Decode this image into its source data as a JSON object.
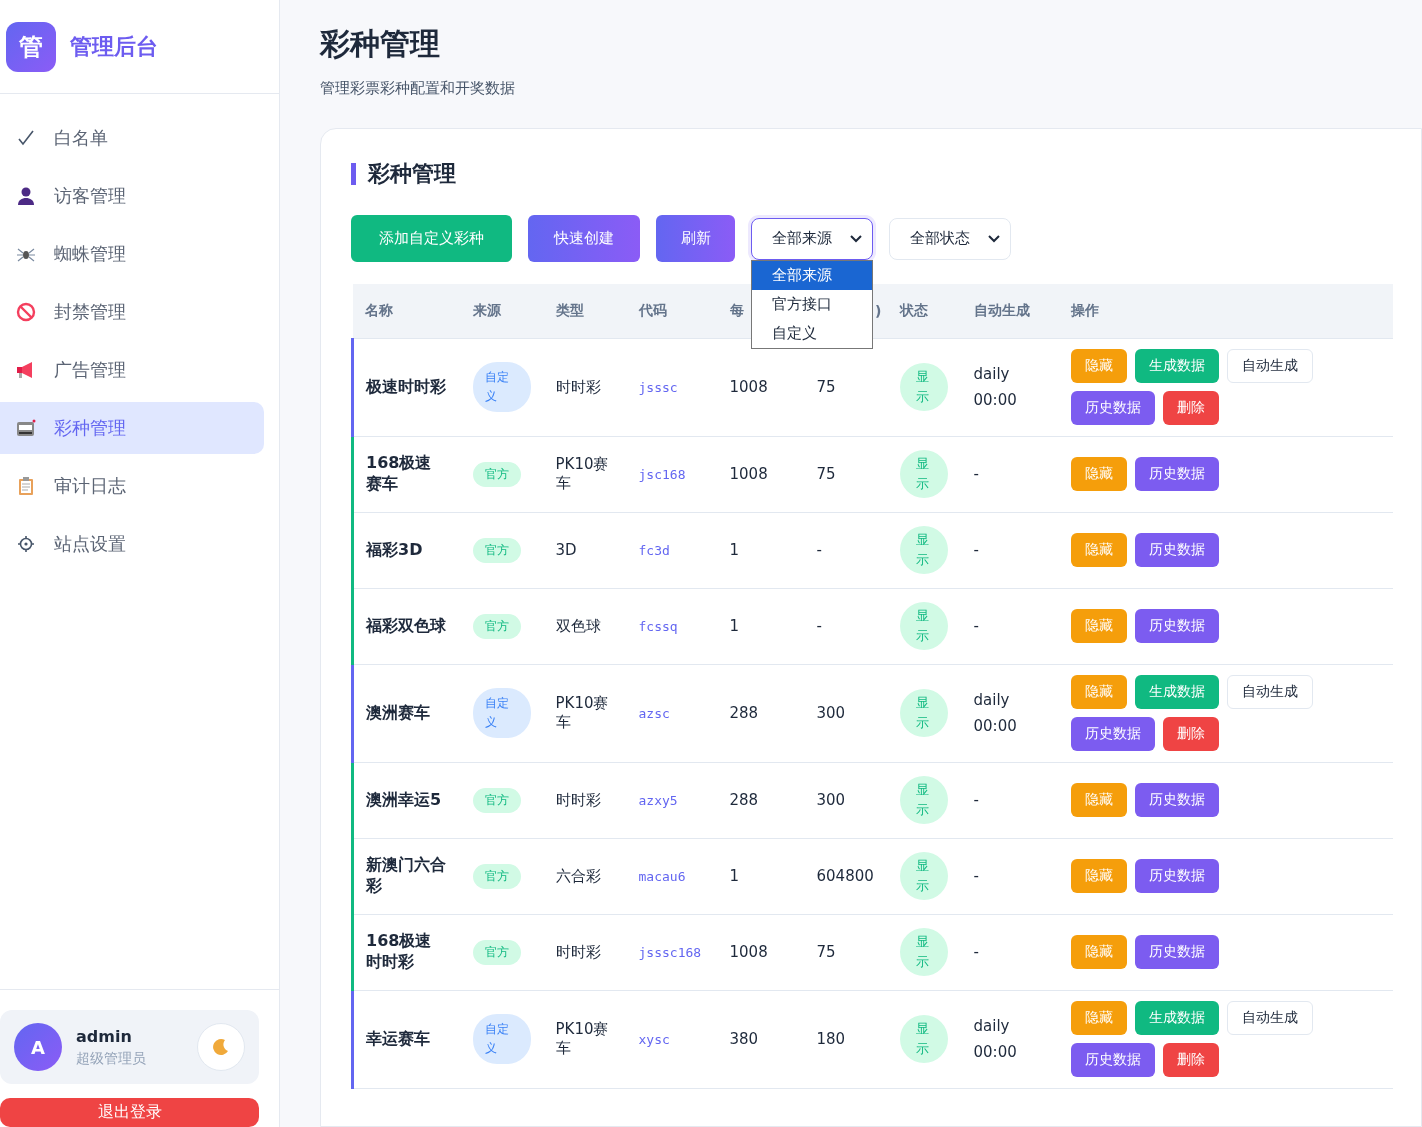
{
  "brand": {
    "logo": "管",
    "title": "管理后台"
  },
  "sidebar": {
    "items": [
      {
        "label": "白名单",
        "selected": false
      },
      {
        "label": "访客管理",
        "selected": false
      },
      {
        "label": "蜘蛛管理",
        "selected": false
      },
      {
        "label": "封禁管理",
        "selected": false
      },
      {
        "label": "广告管理",
        "selected": false
      },
      {
        "label": "彩种管理",
        "selected": true
      },
      {
        "label": "审计日志",
        "selected": false
      },
      {
        "label": "站点设置",
        "selected": false
      }
    ]
  },
  "user": {
    "avatar": "A",
    "name": "admin",
    "role": "超级管理员"
  },
  "logout": "退出登录",
  "page": {
    "title": "彩种管理",
    "subtitle": "管理彩票彩种配置和开奖数据"
  },
  "card": {
    "title": "彩种管理"
  },
  "toolbar": {
    "buttons": [
      {
        "label": "添加自定义彩种",
        "kind": "green"
      },
      {
        "label": "快速创建",
        "kind": "purple"
      },
      {
        "label": "刷新",
        "kind": "purple"
      }
    ],
    "source_select": {
      "value": "全部来源",
      "expanded": true,
      "options": [
        {
          "label": "全部来源",
          "selected": true
        },
        {
          "label": "官方接口",
          "selected": false
        },
        {
          "label": "自定义",
          "selected": false
        }
      ]
    },
    "status_select": {
      "value": "全部状态"
    }
  },
  "table": {
    "columns": [
      "名称",
      "来源",
      "类型",
      "代码",
      "每",
      ")",
      "状态",
      "自动生成",
      "操作"
    ],
    "rows": [
      {
        "name": "极速时时彩",
        "source": {
          "label": "自定义",
          "kind": "custom"
        },
        "type": "时时彩",
        "code": "jsssc",
        "column_5": "1008",
        "column_6": "75",
        "status": "显示",
        "auto": "daily 00:00",
        "actions": [
          {
            "label": "隐藏",
            "kind": "hide"
          },
          {
            "label": "生成数据",
            "kind": "generate"
          },
          {
            "label": "自动生成",
            "kind": "auto"
          },
          {
            "label": "历史数据",
            "kind": "history"
          },
          {
            "label": "删除",
            "kind": "delete"
          }
        ]
      },
      {
        "name": "168极速赛车",
        "source": {
          "label": "官方",
          "kind": "official"
        },
        "type": "PK10赛车",
        "code": "jsc168",
        "column_5": "1008",
        "column_6": "75",
        "status": "显示",
        "auto": "-",
        "actions": [
          {
            "label": "隐藏",
            "kind": "hide"
          },
          {
            "label": "历史数据",
            "kind": "history"
          }
        ]
      },
      {
        "name": "福彩3D",
        "source": {
          "label": "官方",
          "kind": "official"
        },
        "type": "3D",
        "code": "fc3d",
        "column_5": "1",
        "column_6": "-",
        "status": "显示",
        "auto": "-",
        "actions": [
          {
            "label": "隐藏",
            "kind": "hide"
          },
          {
            "label": "历史数据",
            "kind": "history"
          }
        ]
      },
      {
        "name": "福彩双色球",
        "source": {
          "label": "官方",
          "kind": "official"
        },
        "type": "双色球",
        "code": "fcssq",
        "column_5": "1",
        "column_6": "-",
        "status": "显示",
        "auto": "-",
        "actions": [
          {
            "label": "隐藏",
            "kind": "hide"
          },
          {
            "label": "历史数据",
            "kind": "history"
          }
        ]
      },
      {
        "name": "澳洲赛车",
        "source": {
          "label": "自定义",
          "kind": "custom"
        },
        "type": "PK10赛车",
        "code": "azsc",
        "column_5": "288",
        "column_6": "300",
        "status": "显示",
        "auto": "daily 00:00",
        "actions": [
          {
            "label": "隐藏",
            "kind": "hide"
          },
          {
            "label": "生成数据",
            "kind": "generate"
          },
          {
            "label": "自动生成",
            "kind": "auto"
          },
          {
            "label": "历史数据",
            "kind": "history"
          },
          {
            "label": "删除",
            "kind": "delete"
          }
        ]
      },
      {
        "name": "澳洲幸运5",
        "source": {
          "label": "官方",
          "kind": "official"
        },
        "type": "时时彩",
        "code": "azxy5",
        "column_5": "288",
        "column_6": "300",
        "status": "显示",
        "auto": "-",
        "actions": [
          {
            "label": "隐藏",
            "kind": "hide"
          },
          {
            "label": "历史数据",
            "kind": "history"
          }
        ]
      },
      {
        "name": "新澳门六合彩",
        "source": {
          "label": "官方",
          "kind": "official"
        },
        "type": "六合彩",
        "code": "macau6",
        "column_5": "1",
        "column_6": "604800",
        "status": "显示",
        "auto": "-",
        "actions": [
          {
            "label": "隐藏",
            "kind": "hide"
          },
          {
            "label": "历史数据",
            "kind": "history"
          }
        ]
      },
      {
        "name": "168极速时时彩",
        "source": {
          "label": "官方",
          "kind": "official"
        },
        "type": "时时彩",
        "code": "jsssc168",
        "column_5": "1008",
        "column_6": "75",
        "status": "显示",
        "auto": "-",
        "actions": [
          {
            "label": "隐藏",
            "kind": "hide"
          },
          {
            "label": "历史数据",
            "kind": "history"
          }
        ]
      },
      {
        "name": "幸运赛车",
        "source": {
          "label": "自定义",
          "kind": "custom"
        },
        "type": "PK10赛车",
        "code": "xysc",
        "column_5": "380",
        "column_6": "180",
        "status": "显示",
        "auto": "daily 00:00",
        "actions": [
          {
            "label": "隐藏",
            "kind": "hide"
          },
          {
            "label": "生成数据",
            "kind": "generate"
          },
          {
            "label": "自动生成",
            "kind": "auto"
          },
          {
            "label": "历史数据",
            "kind": "history"
          },
          {
            "label": "删除",
            "kind": "delete"
          }
        ]
      }
    ]
  }
}
